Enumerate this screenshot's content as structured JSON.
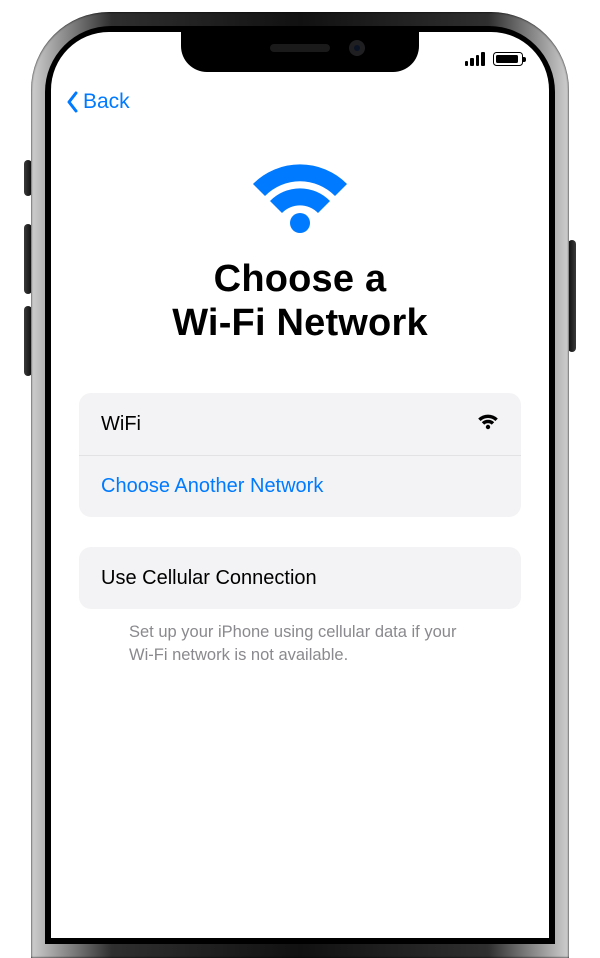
{
  "colors": {
    "accent": "#007aff"
  },
  "statusbar": {
    "signal_bars": 4
  },
  "nav": {
    "back_label": "Back"
  },
  "hero": {
    "title_line1": "Choose a",
    "title_line2": "Wi-Fi Network"
  },
  "networks": {
    "items": [
      {
        "name": "WiFi"
      }
    ],
    "other_label": "Choose Another Network"
  },
  "cellular": {
    "action_label": "Use Cellular Connection",
    "hint": "Set up your iPhone using cellular data if your Wi-Fi network is not available."
  }
}
